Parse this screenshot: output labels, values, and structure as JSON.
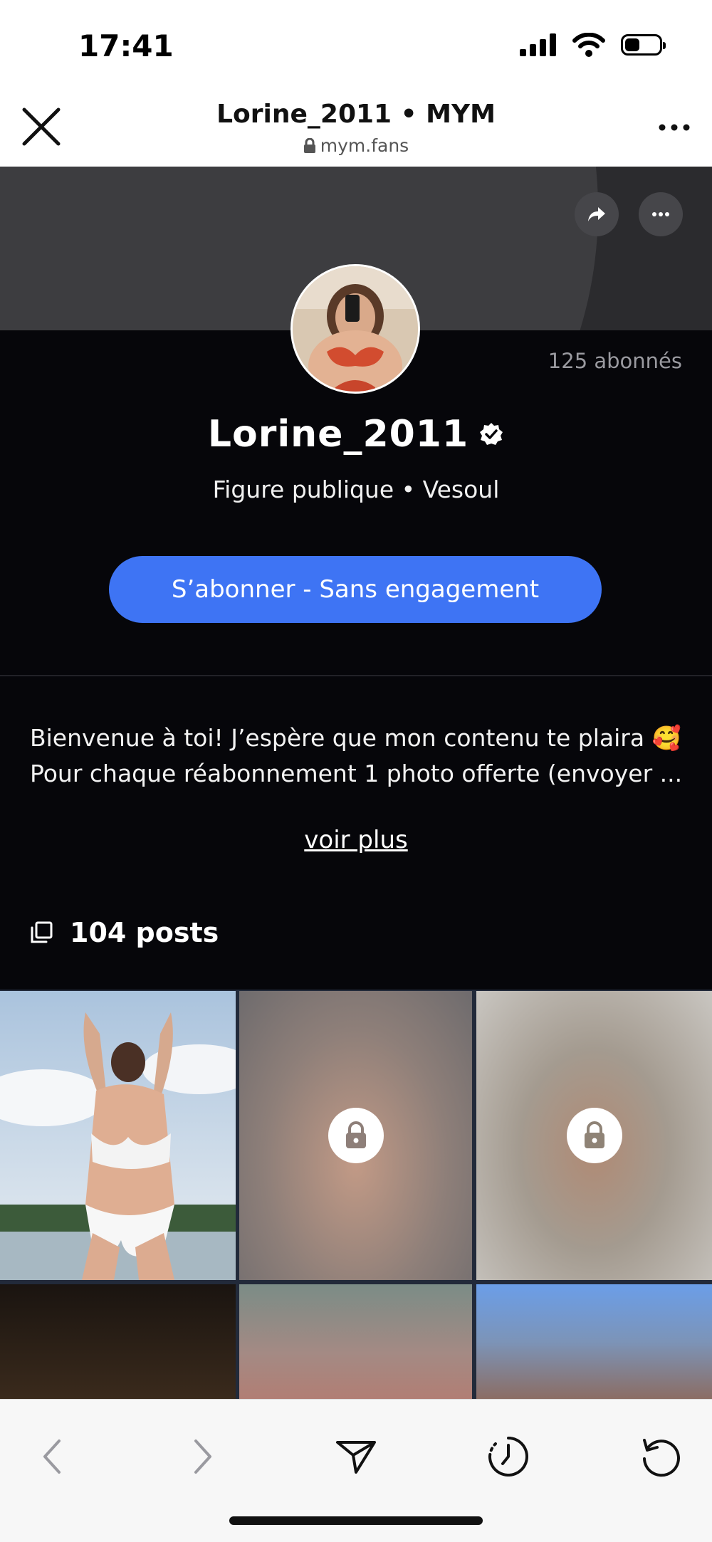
{
  "status_bar": {
    "time": "17:41"
  },
  "browser": {
    "title": "Lorine_2011 • MYM",
    "url": "mym.fans"
  },
  "profile": {
    "subscribers": "125 abonnés",
    "username": "Lorine_2011",
    "verified": true,
    "meta": "Figure publique • Vesoul",
    "subscribe_label": "S’abonner - Sans engagement",
    "bio_line1": "Bienvenue à toi! J’espère que mon contenu te plaira 🥰",
    "bio_line2": "Pour chaque réabonnement 1 photo offerte (envoyer ...",
    "see_more": "voir plus",
    "posts_count": "104 posts"
  },
  "grid": {
    "tiles": [
      {
        "locked": false
      },
      {
        "locked": true
      },
      {
        "locked": true
      },
      {
        "locked": false
      },
      {
        "locked": false
      },
      {
        "locked": false
      }
    ]
  },
  "colors": {
    "accent": "#3e74f4",
    "background": "#06060a",
    "cover": "#2b2b2e"
  },
  "icons": [
    "close-icon",
    "lock-small-icon",
    "more-horizontal-icon",
    "share-icon",
    "more-icon",
    "verified-badge-icon",
    "posts-stack-icon",
    "lock-icon",
    "back-arrow-icon",
    "forward-arrow-icon",
    "send-icon",
    "history-icon",
    "reload-icon"
  ]
}
